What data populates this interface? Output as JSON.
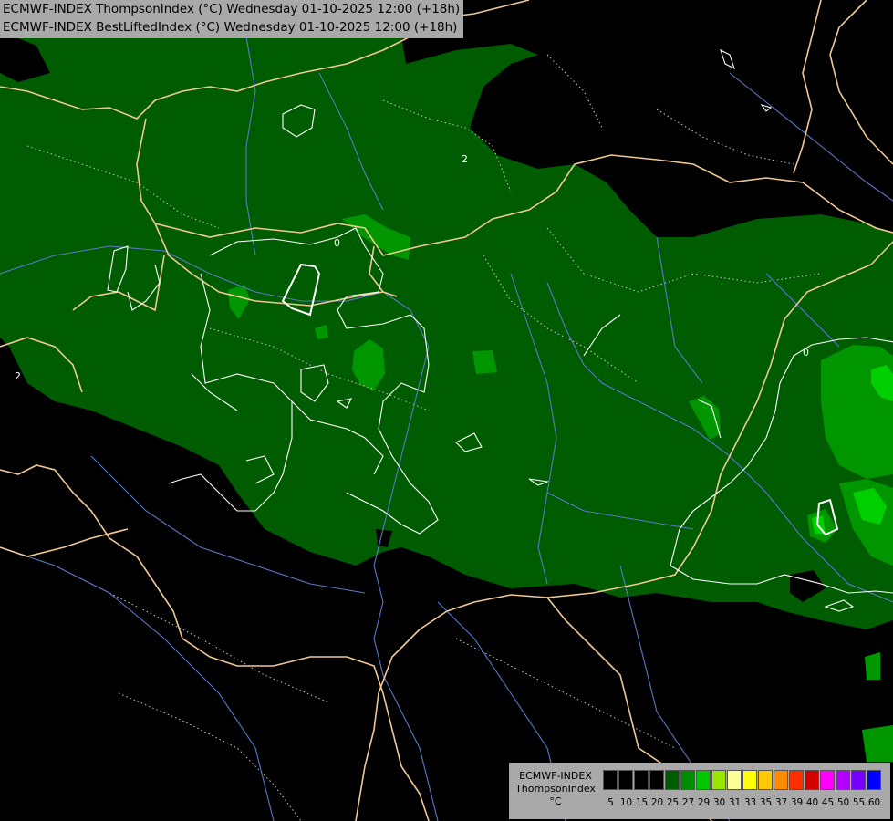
{
  "header": {
    "line1": "ECMWF-INDEX ThompsonIndex (°C) Wednesday 01-10-2025 12:00 (+18h)",
    "line2": "ECMWF-INDEX BestLiftedIndex (°C) Wednesday 01-10-2025 12:00 (+18h)"
  },
  "map": {
    "contour_labels": [
      "2",
      "0",
      "2",
      "0"
    ],
    "colors": {
      "background": "#000000",
      "main_fill": "#005c00",
      "medium_fill": "#009600",
      "bright_fill": "#00d000",
      "border": "#f0c896",
      "rivers": "#5a78c8",
      "contour": "#ffffff"
    }
  },
  "legend": {
    "name_line1": "ECMWF-INDEX",
    "name_line2": "ThompsonIndex",
    "unit": "°C",
    "ticks": [
      "5",
      "10",
      "15",
      "20",
      "25",
      "27",
      "29",
      "30",
      "31",
      "33",
      "35",
      "37",
      "39",
      "40",
      "45",
      "50",
      "55",
      "60"
    ],
    "colors": [
      "#000000",
      "#000000",
      "#000000",
      "#000000",
      "#005c00",
      "#008c00",
      "#00c800",
      "#9be600",
      "#ffff99",
      "#ffff00",
      "#ffc800",
      "#ff8c00",
      "#ff3000",
      "#d20000",
      "#ff00ff",
      "#b400ff",
      "#7800ff",
      "#0000ff"
    ]
  }
}
